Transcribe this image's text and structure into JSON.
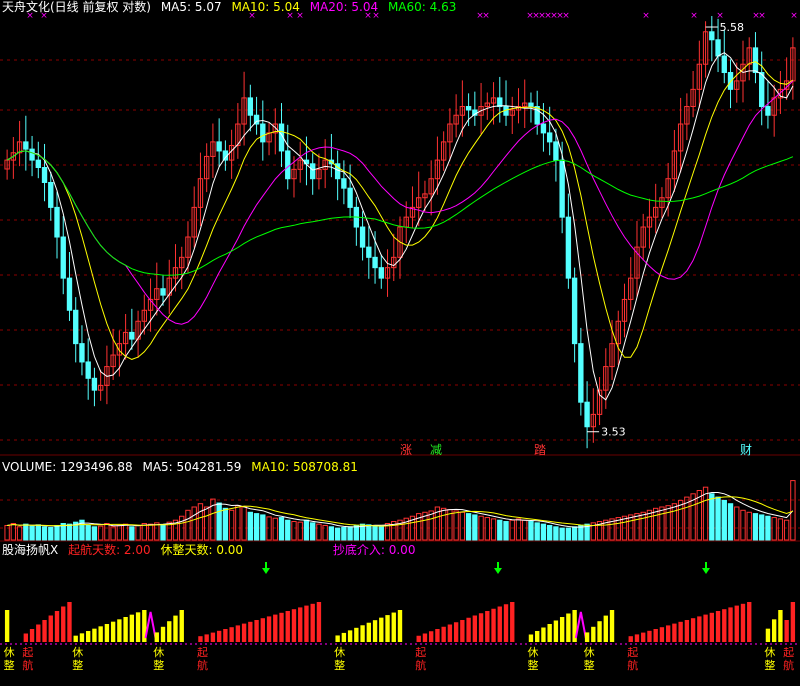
{
  "colors": {
    "bg": "#000000",
    "up": "#ff3232",
    "down": "#54ffff",
    "ma5": "#ffffff",
    "ma10": "#ffff00",
    "ma20": "#ff00ff",
    "ma60": "#00ff00",
    "grid": "#8b0000",
    "sail": "#ff2222",
    "rest": "#ffff00",
    "arrow": "#00ff00",
    "marker": "#ff00ff"
  },
  "main_header": {
    "title": "天舟文化(日线 前复权 对数)",
    "ma5": "MA5: 5.07",
    "ma10": "MA10: 5.04",
    "ma20": "MA20: 5.04",
    "ma60": "MA60: 4.63"
  },
  "volume_header": {
    "label": "VOLUME: 1293496.88",
    "ma5": "MA5: 504281.59",
    "ma10": "MA10: 508708.81"
  },
  "indicator_header": {
    "name": "股海扬帆X",
    "sail_days": "起航天数: 2.00",
    "rest_days": "休整天数: 0.00",
    "bottom_entry": "抄底介入: 0.00"
  },
  "annotations": {
    "high_label": "5.58",
    "low_label": "3.53",
    "tags": [
      {
        "text": "涨",
        "color": "#ff3232"
      },
      {
        "text": "减",
        "color": "#22ee22"
      },
      {
        "text": "踏",
        "color": "#ff3232"
      },
      {
        "text": "财",
        "color": "#54ffff"
      }
    ],
    "sail_label": "起航",
    "rest_label": "休整"
  },
  "chart_data": [
    {
      "type": "candlestick",
      "title": "天舟文化(日线 前复权 对数)",
      "ylim": [
        3.45,
        5.65
      ],
      "log_scale": true,
      "grid": true,
      "high": 5.58,
      "low": 3.53,
      "last_ma": {
        "MA5": 5.07,
        "MA10": 5.04,
        "MA20": 5.04,
        "MA60": 4.63
      },
      "close": [
        4.8,
        4.84,
        4.9,
        4.86,
        4.8,
        4.76,
        4.68,
        4.55,
        4.4,
        4.2,
        4.05,
        3.9,
        3.82,
        3.75,
        3.7,
        3.72,
        3.8,
        3.85,
        3.9,
        3.95,
        3.92,
        4.0,
        4.05,
        4.1,
        4.15,
        4.12,
        4.2,
        4.25,
        4.3,
        4.4,
        4.55,
        4.7,
        4.82,
        4.9,
        4.85,
        4.8,
        4.88,
        5.0,
        5.15,
        5.05,
        5.0,
        4.9,
        4.95,
        5.0,
        4.85,
        4.7,
        4.75,
        4.8,
        4.78,
        4.7,
        4.75,
        4.8,
        4.78,
        4.7,
        4.65,
        4.55,
        4.45,
        4.35,
        4.3,
        4.25,
        4.2,
        4.25,
        4.3,
        4.45,
        4.5,
        4.55,
        4.6,
        4.62,
        4.7,
        4.8,
        4.9,
        5.0,
        5.05,
        5.1,
        5.08,
        5.05,
        5.1,
        5.12,
        5.15,
        5.1,
        5.05,
        5.08,
        5.1,
        5.12,
        5.1,
        5.0,
        4.95,
        4.9,
        4.8,
        4.5,
        4.2,
        3.9,
        3.65,
        3.55,
        3.6,
        3.7,
        3.8,
        3.9,
        4.0,
        4.1,
        4.2,
        4.35,
        4.45,
        4.5,
        4.55,
        4.6,
        4.7,
        4.85,
        5.0,
        5.1,
        5.2,
        5.35,
        5.55,
        5.5,
        5.4,
        5.3,
        5.2,
        5.25,
        5.35,
        5.45,
        5.3,
        5.1,
        5.05,
        5.15,
        5.2,
        5.25,
        5.45
      ],
      "series_ma": [
        "MA5",
        "MA10",
        "MA20",
        "MA60"
      ]
    },
    {
      "type": "bar",
      "title": "VOLUME",
      "values": [
        0.22,
        0.25,
        0.2,
        0.24,
        0.21,
        0.23,
        0.2,
        0.19,
        0.22,
        0.25,
        0.24,
        0.27,
        0.3,
        0.22,
        0.2,
        0.21,
        0.25,
        0.2,
        0.22,
        0.24,
        0.2,
        0.22,
        0.25,
        0.24,
        0.26,
        0.22,
        0.27,
        0.3,
        0.36,
        0.45,
        0.5,
        0.55,
        0.5,
        0.62,
        0.56,
        0.48,
        0.45,
        0.52,
        0.5,
        0.42,
        0.4,
        0.38,
        0.35,
        0.33,
        0.34,
        0.3,
        0.28,
        0.27,
        0.3,
        0.26,
        0.24,
        0.22,
        0.2,
        0.18,
        0.19,
        0.2,
        0.22,
        0.24,
        0.23,
        0.22,
        0.2,
        0.25,
        0.28,
        0.3,
        0.33,
        0.36,
        0.4,
        0.42,
        0.44,
        0.5,
        0.48,
        0.46,
        0.44,
        0.42,
        0.4,
        0.38,
        0.36,
        0.34,
        0.32,
        0.3,
        0.28,
        0.3,
        0.32,
        0.3,
        0.28,
        0.26,
        0.24,
        0.22,
        0.2,
        0.18,
        0.18,
        0.2,
        0.22,
        0.24,
        0.26,
        0.28,
        0.3,
        0.32,
        0.34,
        0.36,
        0.38,
        0.4,
        0.42,
        0.45,
        0.48,
        0.5,
        0.52,
        0.55,
        0.6,
        0.65,
        0.7,
        0.75,
        0.8,
        0.7,
        0.65,
        0.6,
        0.55,
        0.5,
        0.45,
        0.42,
        0.4,
        0.38,
        0.36,
        0.34,
        0.32,
        0.3,
        0.9
      ],
      "values_unit": "fraction of panel max"
    },
    {
      "type": "bar",
      "title": "股海扬帆X",
      "sail_days": 2.0,
      "rest_days": 0.0,
      "bottom_entry": 0.0,
      "phases": [
        {
          "kind": "rest",
          "len": 1
        },
        {
          "kind": "gap",
          "len": 2
        },
        {
          "kind": "sail",
          "len": 8
        },
        {
          "kind": "rest",
          "len": 12
        },
        {
          "kind": "marker",
          "len": 1
        },
        {
          "kind": "rest",
          "len": 5
        },
        {
          "kind": "gap",
          "len": 2
        },
        {
          "kind": "sail",
          "len": 20
        },
        {
          "kind": "gap",
          "len": 2
        },
        {
          "kind": "rest",
          "len": 11
        },
        {
          "kind": "gap",
          "len": 2
        },
        {
          "kind": "sail",
          "len": 16
        },
        {
          "kind": "gap",
          "len": 2
        },
        {
          "kind": "rest",
          "len": 8
        },
        {
          "kind": "marker",
          "len": 1
        },
        {
          "kind": "rest",
          "len": 5
        },
        {
          "kind": "gap",
          "len": 2
        },
        {
          "kind": "sail",
          "len": 20
        },
        {
          "kind": "gap",
          "len": 2
        },
        {
          "kind": "rest",
          "len": 3
        },
        {
          "kind": "sail",
          "len": 2
        }
      ]
    }
  ]
}
